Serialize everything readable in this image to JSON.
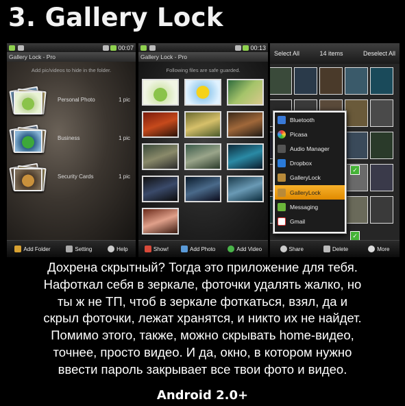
{
  "title": "3. Gallery Lock",
  "phone1": {
    "time": "00:07",
    "app_title": "Gallery Lock - Pro",
    "subtitle": "Add pic/videos to hide in the folder.",
    "folders": [
      {
        "name": "Personal Photo",
        "count": "1 pic"
      },
      {
        "name": "Business",
        "count": "1 pic"
      },
      {
        "name": "Security Cards",
        "count": "1 pic"
      }
    ],
    "bottom": [
      "Add Folder",
      "Setting",
      "Help"
    ]
  },
  "phone2": {
    "time": "00:13",
    "app_title": "Gallery Lock - Pro",
    "subtitle": "Following files are safe guarded.",
    "bottom": [
      "Show!",
      "Add Photo",
      "Add Video"
    ]
  },
  "phone3": {
    "select_all": "Select All",
    "items": "14 items",
    "deselect_all": "Deselect All",
    "menu": [
      "Bluetooth",
      "Picasa",
      "Audio Manager",
      "Dropbox",
      "GalleryLock",
      "GalleryLock",
      "Messaging",
      "Gmail"
    ],
    "menu_selected": 5,
    "bottom": [
      "Share",
      "Delete",
      "More"
    ]
  },
  "description": [
    "Дохрена скрытный? Тогда это приложение для тебя.",
    "Нафоткал себя в зеркале, фоточки удалять жалко, но",
    "ты ж не ТП, чтоб в зеркале фоткаться, взял, да и",
    "скрыл фоточки, лежат хранятся, и никто их не найдет.",
    "Помимо этого, также, можно скрывать home-видео,",
    "точнее, просто видео. И да, окно, в котором нужно",
    "ввести пароль закрывает все твои фото и видео."
  ],
  "android": "Android 2.0+",
  "colors": {
    "accent": "#f7a31e",
    "check": "#45b437"
  }
}
